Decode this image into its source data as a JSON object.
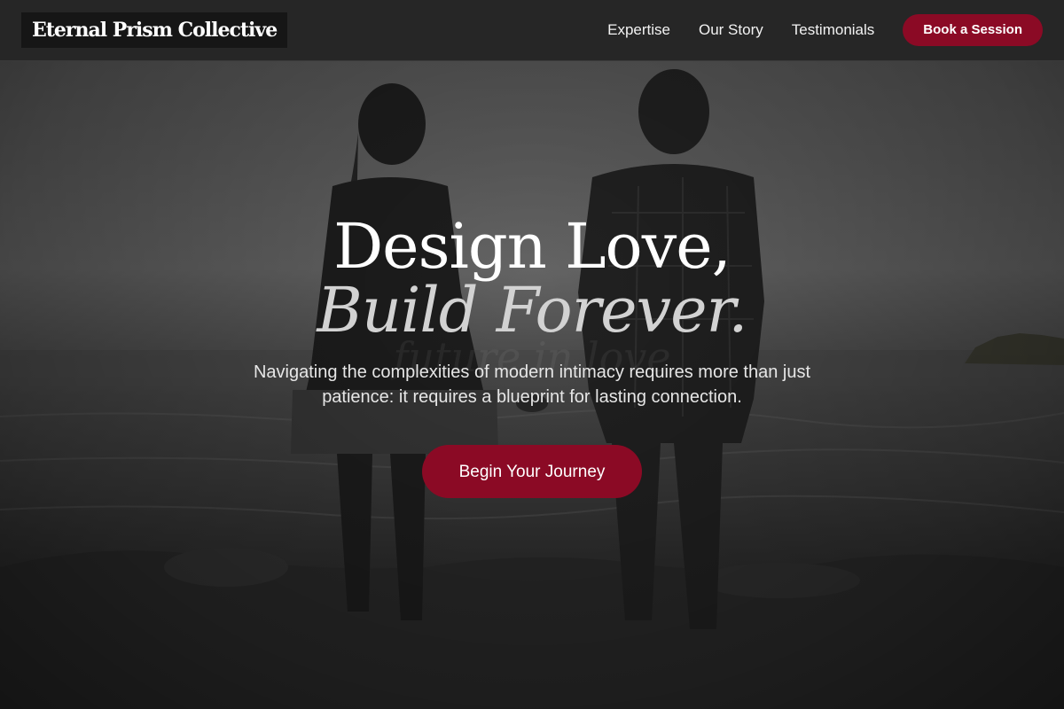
{
  "header": {
    "brand": "Eternal Prism Collective",
    "nav": {
      "links": [
        "Expertise",
        "Our Story",
        "Testimonials"
      ],
      "cta_label": "Book a Session"
    }
  },
  "hero": {
    "title_line1": "Design Love,",
    "title_line2": "Build Forever.",
    "background_ghost_text": "future in love",
    "subtitle": "Navigating the complexities of modern intimacy requires more than just patience: it requires a blueprint for lasting connection.",
    "cta_label": "Begin Your Journey",
    "background_image": "couple-holding-hands-at-seashore-photo"
  },
  "colors": {
    "accent": "#8b0a25",
    "header_bg": "#262626",
    "text_primary": "#ffffff",
    "text_secondary": "#d2d2d2"
  }
}
